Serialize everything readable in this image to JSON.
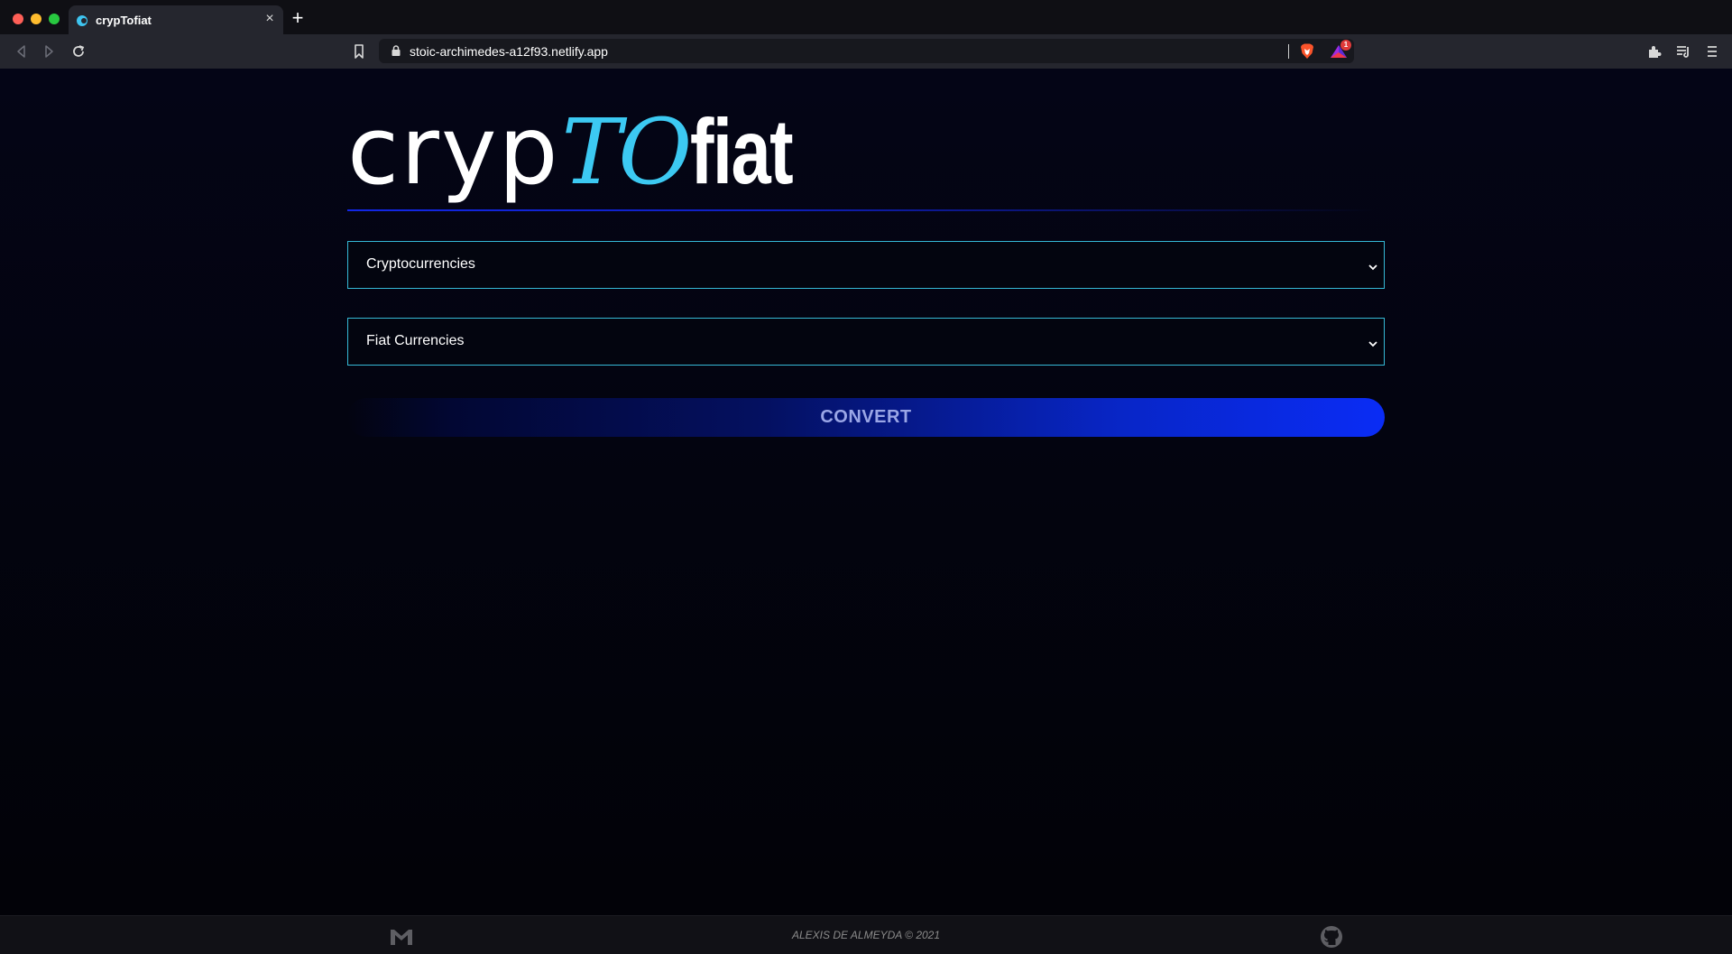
{
  "browser": {
    "tab_title": "crypTofiat",
    "tab_close": "×",
    "new_tab": "+",
    "url": "stoic-archimedes-a12f93.netlify.app",
    "rewards_badge": "1"
  },
  "logo": {
    "part1": "cryp",
    "part2": "TO",
    "part3": "fiat"
  },
  "form": {
    "crypto_select": "Cryptocurrencies",
    "fiat_select": "Fiat Currencies",
    "convert_label": "CONVERT"
  },
  "footer": {
    "copyright": "ALEXIS DE ALMEYDA © 2021"
  },
  "colors": {
    "accent_cyan": "#3cc9f2",
    "accent_blue": "#0a2cf5",
    "select_border": "#35b9d6"
  },
  "icons": [
    "back-icon",
    "forward-icon",
    "reload-icon",
    "bookmark-icon",
    "lock-icon",
    "brave-shield-icon",
    "brave-rewards-icon",
    "extensions-icon",
    "media-icon",
    "menu-icon",
    "gmail-icon",
    "github-icon",
    "chevron-down-icon"
  ]
}
